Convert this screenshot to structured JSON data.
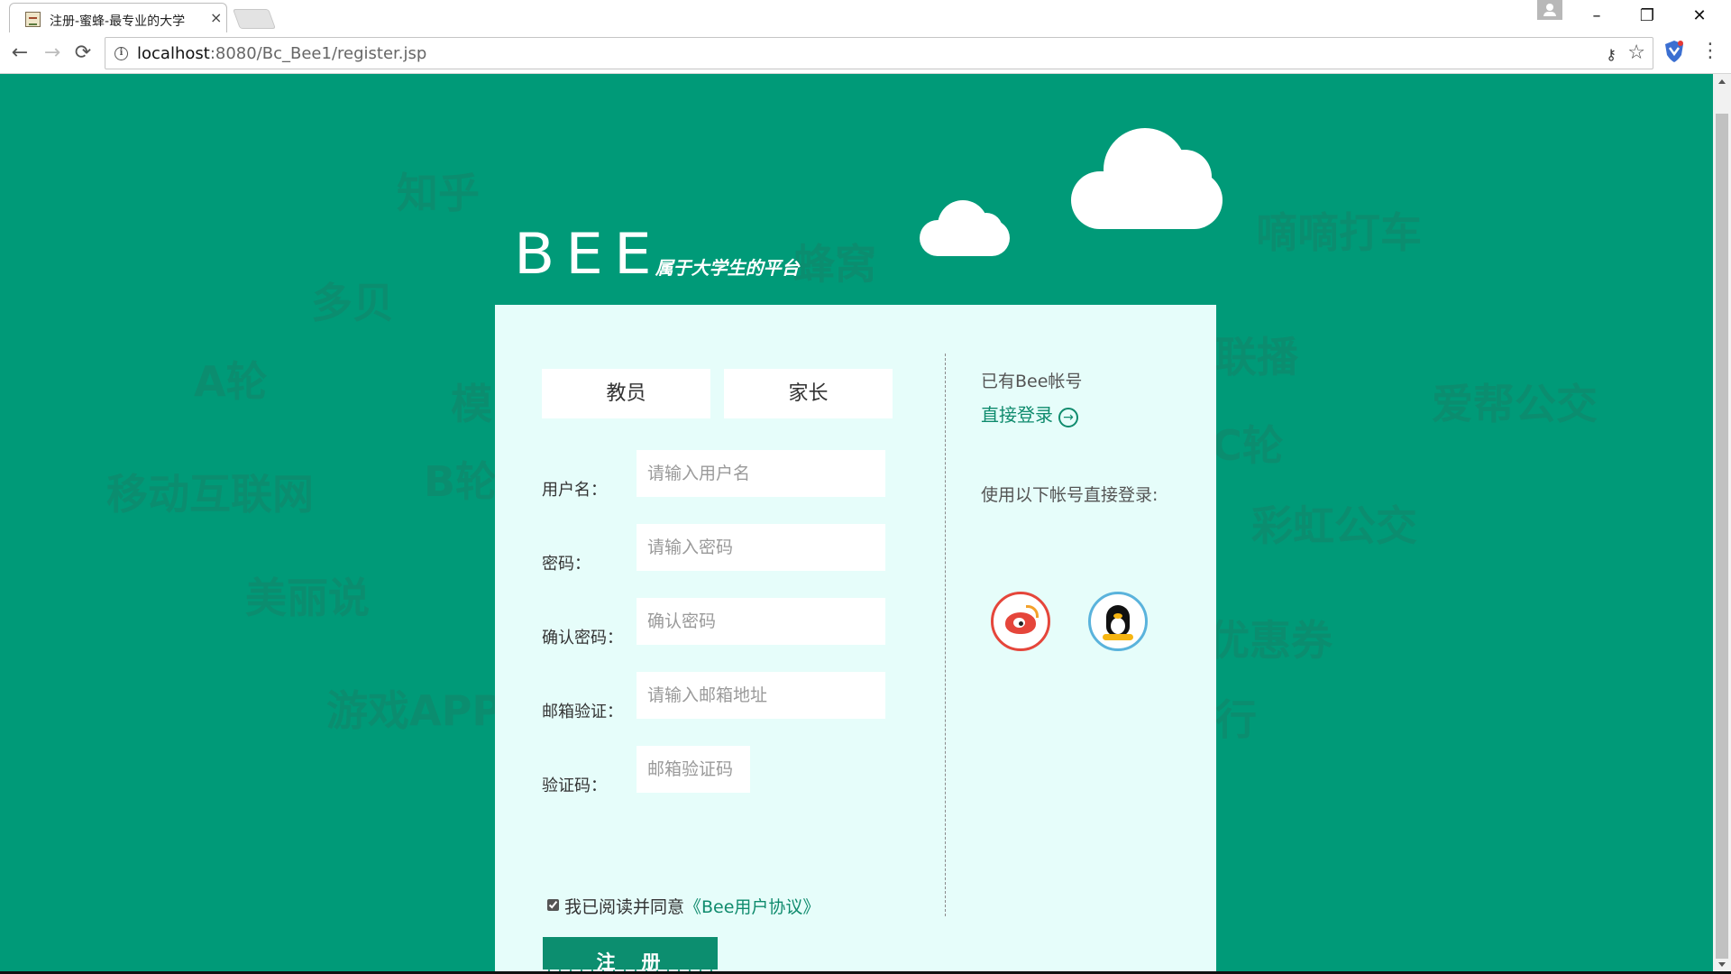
{
  "browser": {
    "tab_title": "注册-蜜蜂-最专业的大学",
    "tab_close": "×",
    "url_host": "localhost",
    "url_rest": ":8080/Bc_Bee1/register.jsp",
    "nav_back": "←",
    "nav_forward": "→",
    "nav_reload": "⟳",
    "win_minimize": "–",
    "win_restore": "❐",
    "win_close": "✕",
    "key_icon": "⚷",
    "star_icon": "☆",
    "menu_icon": "⋮",
    "info_icon": "i"
  },
  "background_words": [
    "知乎",
    "多贝",
    "A轮",
    "模",
    "B轮",
    "移动互联网",
    "美丽说",
    "游戏APP",
    "嘀嘀打车",
    "联播",
    "爱帮公交",
    "C轮",
    "彩虹公交",
    "优惠券",
    "行",
    "蜂窝"
  ],
  "logo": {
    "main": "BEE",
    "tagline": "属于大学生的平台"
  },
  "register": {
    "role_teacher": "教员",
    "role_parent": "家长",
    "fields": [
      {
        "label": "用户名：",
        "placeholder": "请输入用户名"
      },
      {
        "label": "密码：",
        "placeholder": "请输入密码"
      },
      {
        "label": "确认密码：",
        "placeholder": "确认密码"
      },
      {
        "label": "邮箱验证：",
        "placeholder": "请输入邮箱地址"
      },
      {
        "label": "验证码：",
        "placeholder": "邮箱验证码"
      }
    ],
    "agree_text": "我已阅读并同意",
    "agree_link": "《Bee用户协议》",
    "agree_checked": true,
    "submit": "注　册"
  },
  "login_side": {
    "has_account": "已有Bee帐号",
    "direct_login": "直接登录",
    "arrow": "→",
    "social_tip": "使用以下帐号直接登录:",
    "social": [
      "weibo-icon",
      "qq-icon"
    ]
  },
  "colors": {
    "page_bg": "#009a78",
    "panel_bg": "#e6fdfa",
    "accent": "#0c8e6f",
    "weibo": "#e5463b",
    "qq": "#5ab3dc"
  }
}
